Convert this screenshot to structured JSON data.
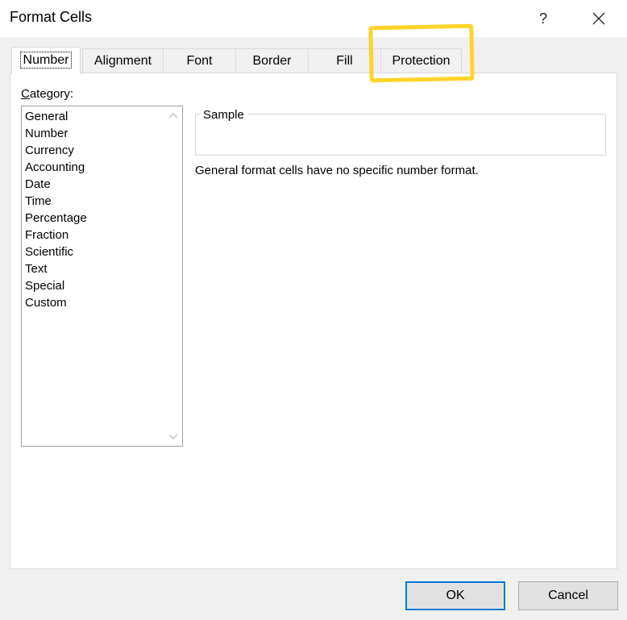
{
  "window": {
    "title": "Format Cells",
    "help_label": "?"
  },
  "tabs": [
    {
      "label": "Number",
      "active": true
    },
    {
      "label": "Alignment",
      "active": false
    },
    {
      "label": "Font",
      "active": false
    },
    {
      "label": "Border",
      "active": false
    },
    {
      "label": "Fill",
      "active": false
    },
    {
      "label": "Protection",
      "active": false
    }
  ],
  "category": {
    "label_prefix": "C",
    "label_rest": "ategory:",
    "items": [
      "General",
      "Number",
      "Currency",
      "Accounting",
      "Date",
      "Time",
      "Percentage",
      "Fraction",
      "Scientific",
      "Text",
      "Special",
      "Custom"
    ]
  },
  "sample": {
    "legend": "Sample",
    "value": ""
  },
  "description": "General format cells have no specific number format.",
  "buttons": {
    "ok": "OK",
    "cancel": "Cancel"
  },
  "colors": {
    "highlight": "#ffd42a",
    "default_button_border": "#0078d7"
  }
}
